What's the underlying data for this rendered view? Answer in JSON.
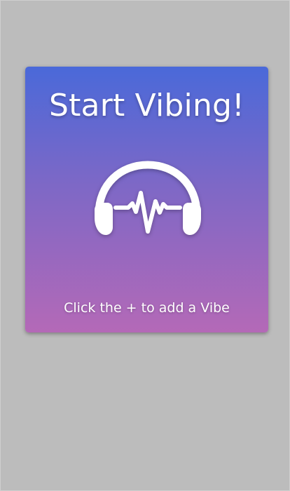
{
  "empty_state": {
    "title": "Start Vibing!",
    "hint": "Click the + to add a Vibe",
    "icon": "headphones-heartbeat-icon"
  },
  "colors": {
    "background": "#bcbcbc",
    "card_gradient_top": "#4a69d9",
    "card_gradient_middle": "#7e68c6",
    "card_gradient_bottom": "#b469b7",
    "foreground": "#ffffff"
  }
}
